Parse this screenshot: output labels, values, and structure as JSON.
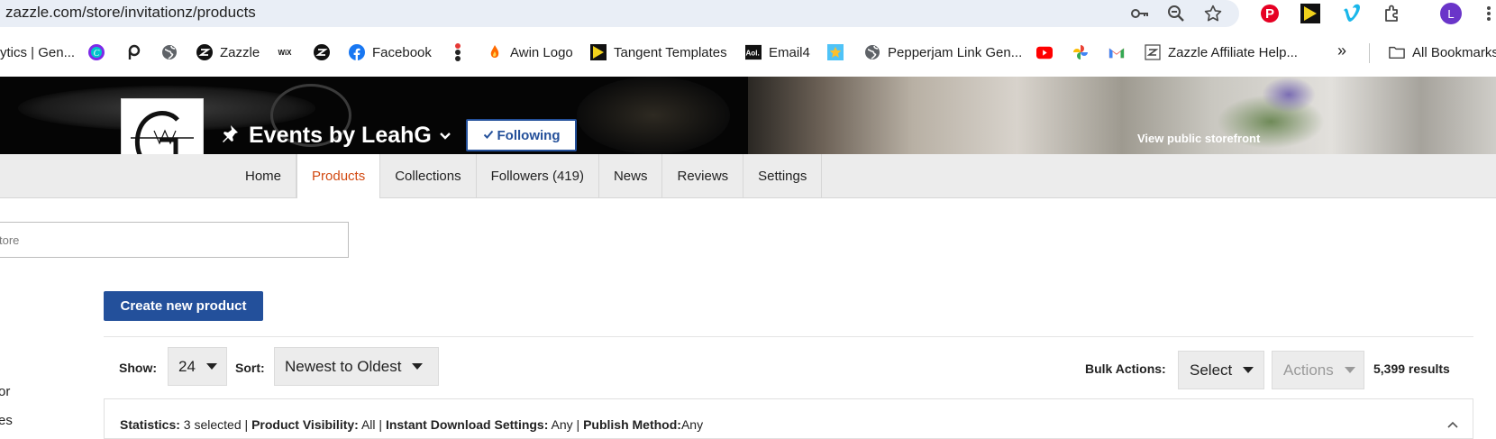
{
  "browser": {
    "url": "zazzle.com/store/invitationz/products",
    "profile_initial": "L",
    "icons": [
      "key-icon",
      "zoom-icon",
      "star-icon",
      "pinterest-icon",
      "tangent-icon",
      "vimeo-icon",
      "extensions-icon",
      "profile-avatar",
      "more-icon"
    ]
  },
  "bookmarks": {
    "items": [
      {
        "label": "ytics | Gen...",
        "icon": "analytics-icon"
      },
      {
        "label": "",
        "icon": "canva-icon"
      },
      {
        "label": "",
        "icon": "picsart-icon"
      },
      {
        "label": "",
        "icon": "globe-icon"
      },
      {
        "label": "Zazzle",
        "icon": "zazzle-icon"
      },
      {
        "label": "",
        "icon": "wix-icon"
      },
      {
        "label": "",
        "icon": "zazzle-icon"
      },
      {
        "label": "Facebook",
        "icon": "facebook-icon"
      },
      {
        "label": "",
        "icon": "traffic-icon"
      },
      {
        "label": "Awin Logo",
        "icon": "awin-icon"
      },
      {
        "label": "Tangent Templates",
        "icon": "tangent-icon"
      },
      {
        "label": "Email4",
        "icon": "aol-icon"
      },
      {
        "label": "",
        "icon": "star-box-icon"
      },
      {
        "label": "Pepperjam Link Gen...",
        "icon": "globe-icon"
      },
      {
        "label": "",
        "icon": "youtube-icon"
      },
      {
        "label": "",
        "icon": "photos-icon"
      },
      {
        "label": "",
        "icon": "gmail-icon"
      },
      {
        "label": "Zazzle Affiliate Help...",
        "icon": "zazzle-help-icon"
      }
    ],
    "overflow_label": "»",
    "all_bookmarks": "All Bookmarks"
  },
  "store": {
    "name": "Events by LeahG",
    "follow_label": "Following",
    "view_public": "View public storefront"
  },
  "tabs": [
    "Home",
    "Products",
    "Collections",
    "Followers (419)",
    "News",
    "Reviews",
    "Settings"
  ],
  "active_tab": "Products",
  "search": {
    "placeholder": "tore"
  },
  "create_button": "Create new product",
  "controls": {
    "show_label": "Show:",
    "show_value": "24",
    "sort_label": "Sort:",
    "sort_value": "Newest to Oldest",
    "bulk_label": "Bulk Actions:",
    "bulk_select": "Select",
    "actions_label": "Actions",
    "results": "5,399 results"
  },
  "sidebar_fragments": [
    "or",
    "es"
  ],
  "stats": {
    "statistics_label": "Statistics:",
    "statistics_value": " 3 selected",
    "visibility_label": "Product Visibility:",
    "visibility_value": " All",
    "download_label": "Instant Download Settings:",
    "download_value": " Any",
    "publish_label": "Publish Method:",
    "publish_value": "Any",
    "separator": " | "
  },
  "colors": {
    "accent": "#23509b",
    "active_tab": "#d24a12",
    "tab_bar": "#ececec"
  }
}
